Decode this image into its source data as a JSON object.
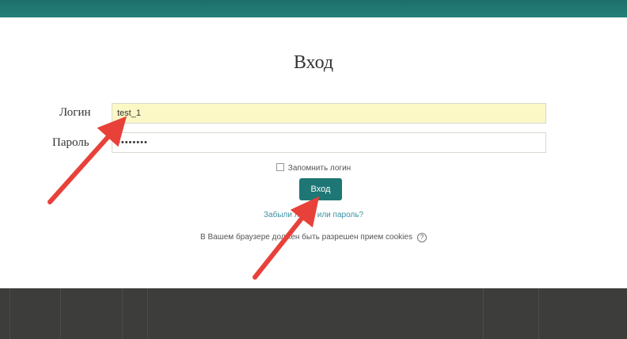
{
  "login_page": {
    "title": "Вход",
    "username_label": "Логин",
    "username_value": "test_1",
    "password_label": "Пароль",
    "password_value": "••••••••",
    "remember_label": "Запомнить логин",
    "login_button": "Вход",
    "forgot_link": "Забыли логин или пароль?",
    "cookies_notice": "В Вашем браузере должен быть разрешен прием cookies",
    "help_icon": "?"
  },
  "annotations": {
    "arrow_color": "#e8413a",
    "arrows": [
      "pointing-to-username-field",
      "pointing-to-login-button"
    ]
  },
  "colors": {
    "header": "#24807a",
    "button": "#1e7775",
    "username_field_bg": "#fbf8c6",
    "link": "#3a8fa0",
    "footer": "#3d3d3b"
  }
}
